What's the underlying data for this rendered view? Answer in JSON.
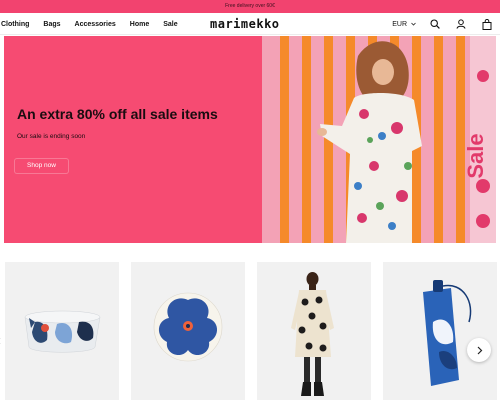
{
  "promo": {
    "text": "Free delivery over 60€"
  },
  "nav": {
    "links": [
      "Clothing",
      "Bags",
      "Accessories",
      "Home",
      "Sale"
    ],
    "logo": "marimekko",
    "currency": "EUR"
  },
  "hero": {
    "title": "An extra 80% off all sale items",
    "subtitle": "Our sale is ending soon",
    "button": "Shop now",
    "image_label": "Sale",
    "bg_color": "#f64b72"
  },
  "products": [
    {
      "name": "bowl-product",
      "icon": "printed-bowl"
    },
    {
      "name": "plate-product",
      "icon": "unikko-plate"
    },
    {
      "name": "dress-product",
      "icon": "model-in-dress"
    },
    {
      "name": "umbrella-product",
      "icon": "folded-umbrella"
    }
  ],
  "colors": {
    "brand_pink": "#f2436f",
    "accent_blue": "#2257a8"
  }
}
